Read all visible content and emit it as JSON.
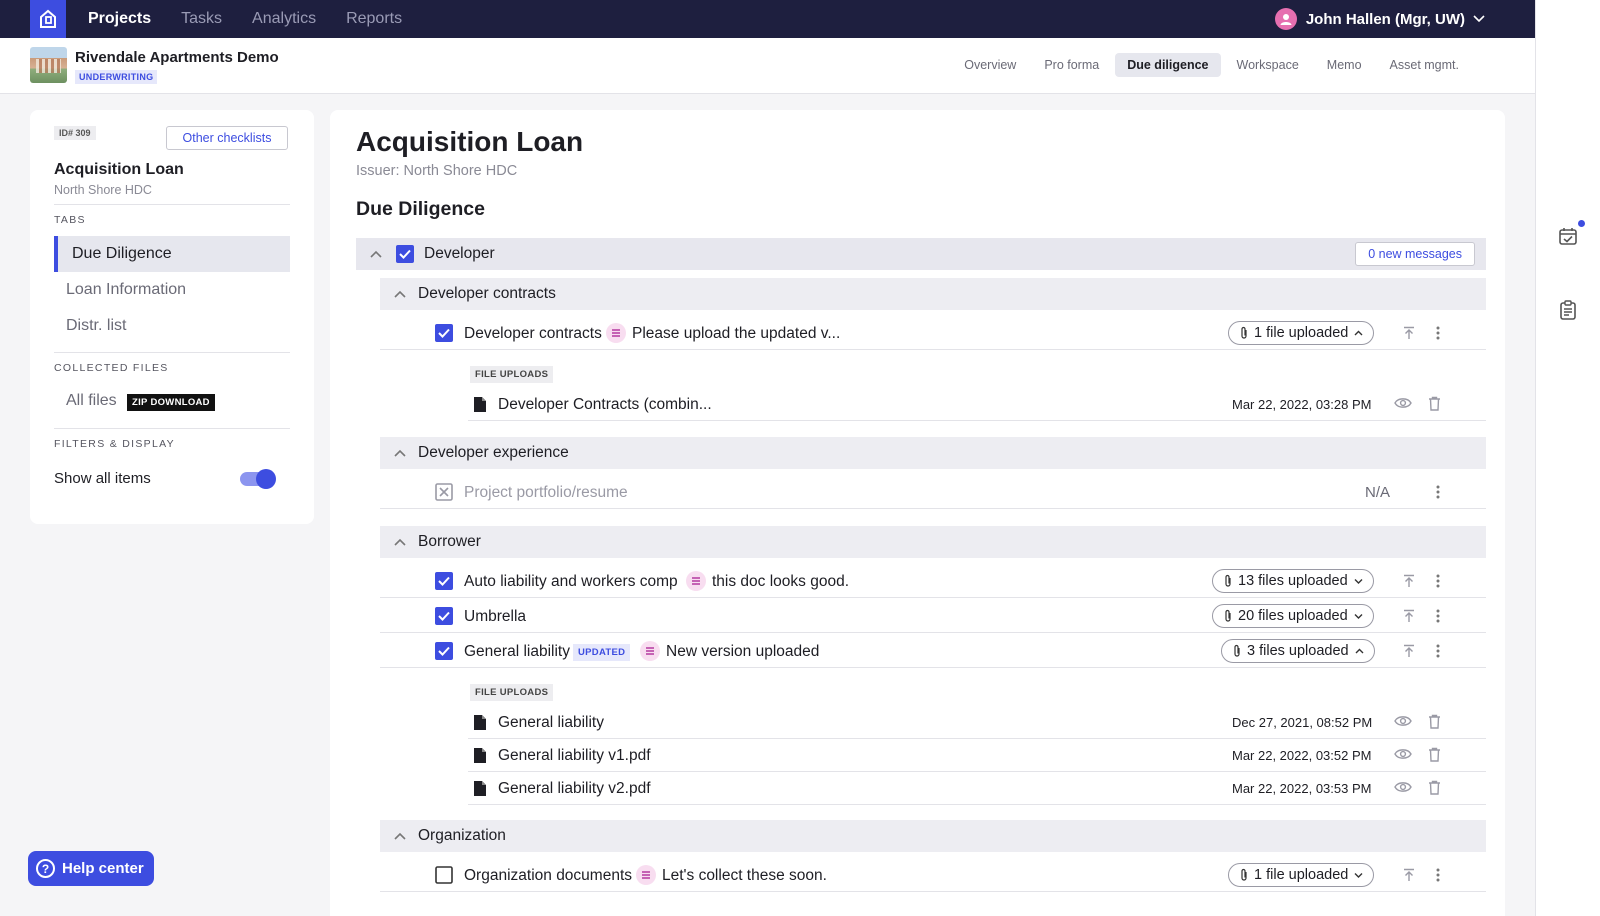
{
  "topnav": {
    "items": [
      {
        "label": "Projects",
        "active": true
      },
      {
        "label": "Tasks",
        "active": false
      },
      {
        "label": "Analytics",
        "active": false
      },
      {
        "label": "Reports",
        "active": false
      }
    ],
    "user": "John Hallen (Mgr, UW)"
  },
  "project": {
    "title": "Rivendale Apartments Demo",
    "badge": "UNDERWRITING",
    "tabs": [
      {
        "label": "Overview",
        "active": false
      },
      {
        "label": "Pro forma",
        "active": false
      },
      {
        "label": "Due diligence",
        "active": true
      },
      {
        "label": "Workspace",
        "active": false
      },
      {
        "label": "Memo",
        "active": false
      },
      {
        "label": "Asset mgmt.",
        "active": false
      }
    ]
  },
  "sidebar": {
    "id_badge": "ID# 309",
    "other_checklists": "Other checklists",
    "title": "Acquisition Loan",
    "subtitle": "North Shore HDC",
    "tabs_header": "TABS",
    "tabs": [
      {
        "label": "Due Diligence",
        "active": true
      },
      {
        "label": "Loan Information",
        "active": false
      },
      {
        "label": "Distr. list",
        "active": false
      }
    ],
    "collected_header": "COLLECTED FILES",
    "all_files": "All files",
    "zip_download": "ZIP DOWNLOAD",
    "filters_header": "FILTERS & DISPLAY",
    "show_all_items": "Show all items",
    "show_all_on": true
  },
  "help": {
    "label": "Help center"
  },
  "main": {
    "title": "Acquisition Loan",
    "issuer": "Issuer: North Shore HDC",
    "section": "Due Diligence",
    "group": {
      "label": "Developer",
      "checked": true,
      "messages": "0 new messages"
    },
    "subgroups": [
      {
        "label": "Developer contracts"
      },
      {
        "label": "Developer experience"
      },
      {
        "label": "Borrower"
      },
      {
        "label": "Organization"
      }
    ],
    "rows": [
      {
        "label": "Developer contracts",
        "note": "Please upload the updated v...",
        "files": "1 file uploaded",
        "checked": true
      },
      {
        "label": "Project portfolio/resume",
        "na": "N/A"
      },
      {
        "label": "Auto liability and workers comp",
        "note": "this doc looks good.",
        "files": "13 files uploaded",
        "checked": true
      },
      {
        "label": "Umbrella",
        "files": "20 files uploaded",
        "checked": true
      },
      {
        "label": "General liability",
        "badge": "UPDATED",
        "note": "New version uploaded",
        "files": "3 files uploaded",
        "checked": true
      },
      {
        "label": "Organization documents",
        "note": "Let's collect these soon.",
        "files": "1 file uploaded",
        "checked": false
      }
    ],
    "file_uploads_label": "FILE UPLOADS",
    "uploads_contracts": [
      {
        "name": "Developer Contracts (combin...",
        "date": "Mar 22, 2022, 03:28 PM"
      }
    ],
    "uploads_liability": [
      {
        "name": "General liability",
        "date": "Dec 27, 2021, 08:52 PM"
      },
      {
        "name": "General liability v1.pdf",
        "date": "Mar 22, 2022, 03:52 PM"
      },
      {
        "name": "General liability v2.pdf",
        "date": "Mar 22, 2022, 03:53 PM"
      }
    ]
  },
  "colors": {
    "accent": "#3d4de0",
    "nav_bg": "#1e1f3f",
    "note_bg": "#f8ddf0"
  }
}
